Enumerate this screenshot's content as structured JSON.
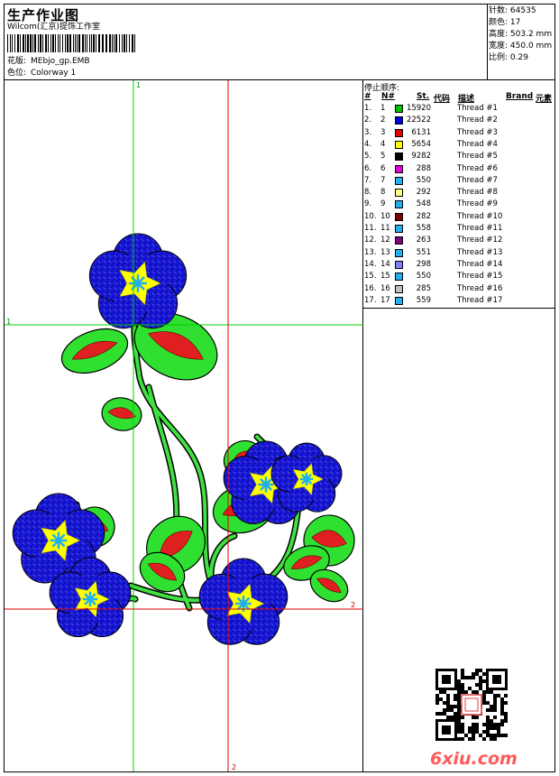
{
  "header": {
    "title": "生产作业图",
    "company": "Wilcom(汇京)提饰工作室",
    "design_label": "花版:",
    "design_value": "MEbjo_gp.EMB",
    "colorway_label": "色位:",
    "colorway_value": "Colorway 1"
  },
  "stats": [
    {
      "label": "针数:",
      "value": "64535"
    },
    {
      "label": "颜色:",
      "value": "17"
    },
    {
      "label": "高度:",
      "value": "503.2 mm"
    },
    {
      "label": "宽度:",
      "value": "450.0 mm"
    },
    {
      "label": "比例:",
      "value": "0.29"
    }
  ],
  "stop_sequence": {
    "title": "停止顺序:",
    "columns": {
      "num": "#",
      "needle": "N#",
      "stitches": "St.",
      "code": "代码",
      "desc": "描述",
      "brand": "Brand",
      "element": "元素"
    },
    "rows": [
      {
        "num": "1.",
        "needle": "1",
        "color": "#00c000",
        "stitches": "15920",
        "desc": "Thread #1"
      },
      {
        "num": "2.",
        "needle": "2",
        "color": "#0000e0",
        "stitches": "22522",
        "desc": "Thread #2"
      },
      {
        "num": "3.",
        "needle": "3",
        "color": "#e00000",
        "stitches": "6131",
        "desc": "Thread #3"
      },
      {
        "num": "4.",
        "needle": "4",
        "color": "#ffff00",
        "stitches": "5654",
        "desc": "Thread #4"
      },
      {
        "num": "5.",
        "needle": "5",
        "color": "#000000",
        "stitches": "9282",
        "desc": "Thread #5"
      },
      {
        "num": "6.",
        "needle": "6",
        "color": "#e000e0",
        "stitches": "288",
        "desc": "Thread #6"
      },
      {
        "num": "7.",
        "needle": "7",
        "color": "#20b0f0",
        "stitches": "550",
        "desc": "Thread #7"
      },
      {
        "num": "8.",
        "needle": "8",
        "color": "#ffff80",
        "stitches": "292",
        "desc": "Thread #8"
      },
      {
        "num": "9.",
        "needle": "9",
        "color": "#20b0f0",
        "stitches": "548",
        "desc": "Thread #9"
      },
      {
        "num": "10.",
        "needle": "10",
        "color": "#800000",
        "stitches": "282",
        "desc": "Thread #10"
      },
      {
        "num": "11.",
        "needle": "11",
        "color": "#20b0f0",
        "stitches": "558",
        "desc": "Thread #11"
      },
      {
        "num": "12.",
        "needle": "12",
        "color": "#800080",
        "stitches": "263",
        "desc": "Thread #12"
      },
      {
        "num": "13.",
        "needle": "13",
        "color": "#20b0f0",
        "stitches": "551",
        "desc": "Thread #13"
      },
      {
        "num": "14.",
        "needle": "14",
        "color": "#8080ff",
        "stitches": "298",
        "desc": "Thread #14"
      },
      {
        "num": "15.",
        "needle": "15",
        "color": "#20b0f0",
        "stitches": "550",
        "desc": "Thread #15"
      },
      {
        "num": "16.",
        "needle": "16",
        "color": "#c0c0c0",
        "stitches": "285",
        "desc": "Thread #16"
      },
      {
        "num": "17.",
        "needle": "17",
        "color": "#20b0f0",
        "stitches": "559",
        "desc": "Thread #17"
      }
    ]
  },
  "guides": {
    "green_v": "1",
    "green_h": "1",
    "red_v": "2",
    "red_h": "2"
  },
  "watermark": "6xiu.com",
  "colors": {
    "green_guide": "#00d000",
    "red_guide": "#e00000"
  }
}
